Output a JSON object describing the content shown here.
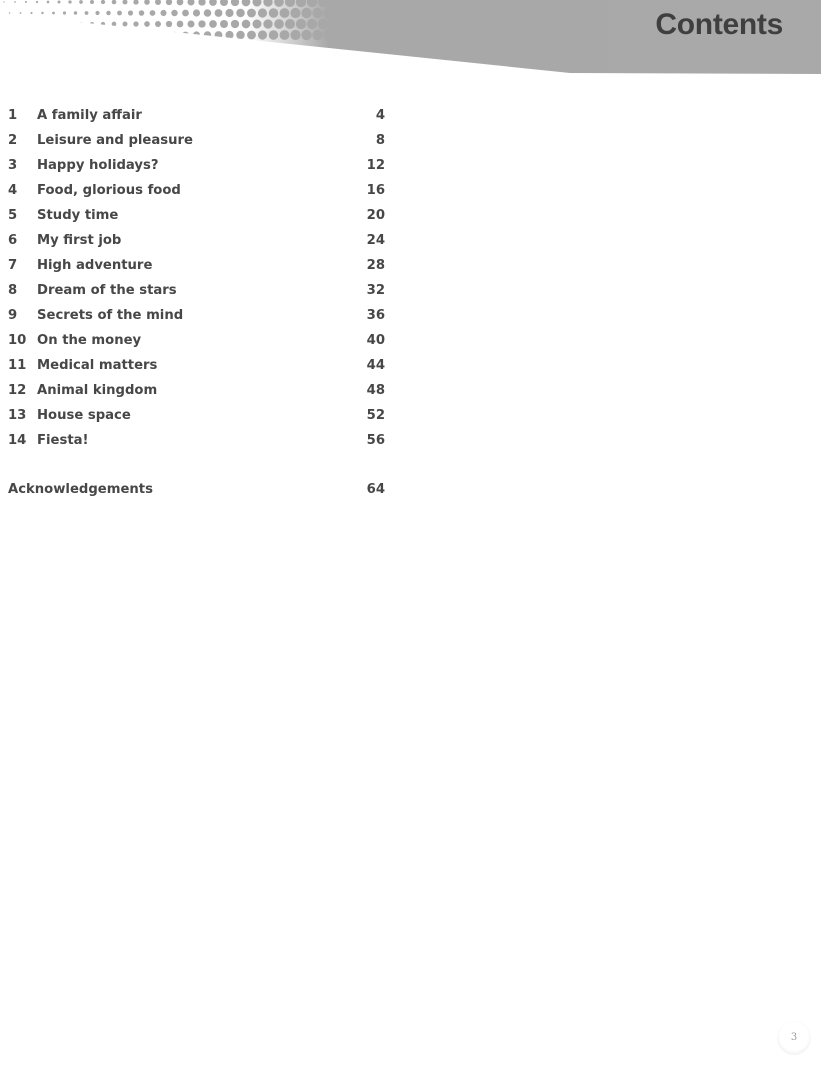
{
  "header": {
    "title": "Contents",
    "banner_color": "#a8a8a8"
  },
  "toc": {
    "entries": [
      {
        "number": "1",
        "title": "A family affair",
        "page": "4"
      },
      {
        "number": "2",
        "title": "Leisure and pleasure",
        "page": "8"
      },
      {
        "number": "3",
        "title": "Happy holidays?",
        "page": "12"
      },
      {
        "number": "4",
        "title": "Food, glorious food",
        "page": "16"
      },
      {
        "number": "5",
        "title": "Study time",
        "page": "20"
      },
      {
        "number": "6",
        "title": "My first job",
        "page": "24"
      },
      {
        "number": "7",
        "title": "High adventure",
        "page": "28"
      },
      {
        "number": "8",
        "title": "Dream of the stars",
        "page": "32"
      },
      {
        "number": "9",
        "title": "Secrets of the mind",
        "page": "36"
      },
      {
        "number": "10",
        "title": "On the money",
        "page": "40"
      },
      {
        "number": "11",
        "title": "Medical matters",
        "page": "44"
      },
      {
        "number": "12",
        "title": "Animal kingdom",
        "page": "48"
      },
      {
        "number": "13",
        "title": "House space",
        "page": "52"
      },
      {
        "number": "14",
        "title": "Fiesta!",
        "page": "56"
      }
    ],
    "acknowledgements": {
      "title": "Acknowledgements",
      "page": "64"
    }
  },
  "footer": {
    "page_number": "3"
  }
}
